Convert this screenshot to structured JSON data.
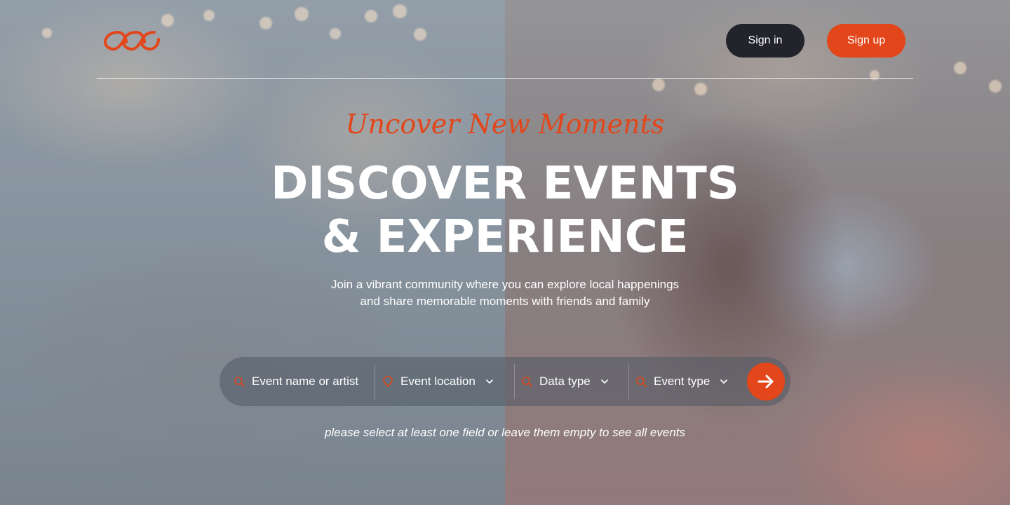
{
  "brand": {
    "logo_icon": "infinity-chain-icon",
    "accent": "#e2461a",
    "dark": "#22232b"
  },
  "header": {
    "signin_label": "Sign in",
    "signup_label": "Sign up"
  },
  "hero": {
    "tagline": "Uncover New Moments",
    "headline_line1": "DISCOVER EVENTS",
    "headline_line2": "& EXPERIENCE",
    "subtext_line1": "Join a vibrant community where you can explore local happenings",
    "subtext_line2": "and share memorable moments with friends and family"
  },
  "search": {
    "fields": [
      {
        "label": "Event name or artist",
        "icon": "search-icon"
      },
      {
        "label": "Event location",
        "icon": "location-icon"
      },
      {
        "label": "Data type",
        "icon": "search-icon"
      },
      {
        "label": "Event type",
        "icon": "search-icon"
      }
    ],
    "submit_icon": "arrow-right-icon",
    "hint": "please select at least one field or leave them empty to see all events"
  }
}
